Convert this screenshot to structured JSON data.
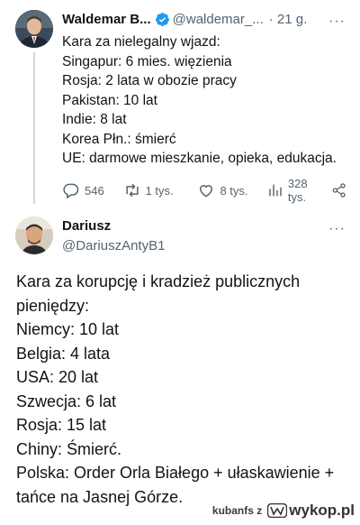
{
  "tweet": {
    "author_name": "Waldemar B...",
    "author_handle": "@waldemar_...",
    "time": "· 21 g.",
    "more": "···",
    "lines": [
      "Kara za nielegalny wjazd:",
      "Singapur: 6 mies. więzienia",
      "Rosja: 2 lata w obozie pracy",
      "Pakistan: 10 lat",
      "Indie: 8 lat",
      "Korea Płn.: śmierć",
      "UE: darmowe mieszkanie, opieka, edukacja."
    ],
    "stats": {
      "replies": "546",
      "retweets": "1 tys.",
      "likes": "8 tys.",
      "views": "328 tys."
    }
  },
  "reply": {
    "author_name": "Dariusz",
    "author_handle": "@DariuszAntyB1",
    "more": "···",
    "lines": [
      "Kara za korupcję i kradzież publicznych",
      "pieniędzy:",
      "Niemcy: 10 lat",
      "Belgia: 4 lata",
      "USA: 20 lat",
      "Szwecja: 6 lat",
      "Rosja: 15 lat",
      "Chiny: Śmierć.",
      "Polska: Order Orla Białego + ułaskawienie +",
      "tańce na Jasnej Górze."
    ]
  },
  "footer": {
    "source": "kubanfs z",
    "site": "wykop.pl"
  },
  "colors": {
    "verified": "#1d9bf0",
    "muted": "#536471",
    "text": "#0f1419"
  }
}
